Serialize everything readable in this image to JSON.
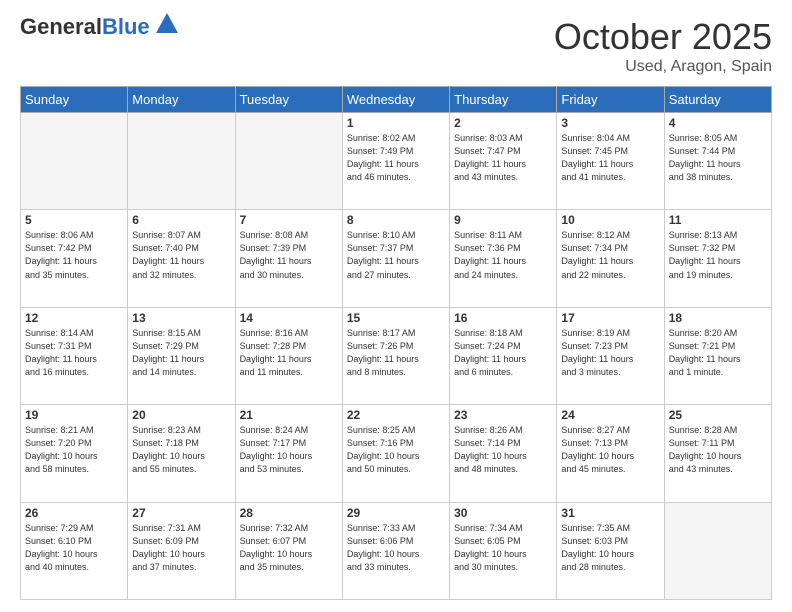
{
  "header": {
    "logo_general": "General",
    "logo_blue": "Blue",
    "title": "October 2025",
    "location": "Used, Aragon, Spain"
  },
  "weekdays": [
    "Sunday",
    "Monday",
    "Tuesday",
    "Wednesday",
    "Thursday",
    "Friday",
    "Saturday"
  ],
  "weeks": [
    [
      {
        "day": "",
        "info": ""
      },
      {
        "day": "",
        "info": ""
      },
      {
        "day": "",
        "info": ""
      },
      {
        "day": "1",
        "info": "Sunrise: 8:02 AM\nSunset: 7:49 PM\nDaylight: 11 hours\nand 46 minutes."
      },
      {
        "day": "2",
        "info": "Sunrise: 8:03 AM\nSunset: 7:47 PM\nDaylight: 11 hours\nand 43 minutes."
      },
      {
        "day": "3",
        "info": "Sunrise: 8:04 AM\nSunset: 7:45 PM\nDaylight: 11 hours\nand 41 minutes."
      },
      {
        "day": "4",
        "info": "Sunrise: 8:05 AM\nSunset: 7:44 PM\nDaylight: 11 hours\nand 38 minutes."
      }
    ],
    [
      {
        "day": "5",
        "info": "Sunrise: 8:06 AM\nSunset: 7:42 PM\nDaylight: 11 hours\nand 35 minutes."
      },
      {
        "day": "6",
        "info": "Sunrise: 8:07 AM\nSunset: 7:40 PM\nDaylight: 11 hours\nand 32 minutes."
      },
      {
        "day": "7",
        "info": "Sunrise: 8:08 AM\nSunset: 7:39 PM\nDaylight: 11 hours\nand 30 minutes."
      },
      {
        "day": "8",
        "info": "Sunrise: 8:10 AM\nSunset: 7:37 PM\nDaylight: 11 hours\nand 27 minutes."
      },
      {
        "day": "9",
        "info": "Sunrise: 8:11 AM\nSunset: 7:36 PM\nDaylight: 11 hours\nand 24 minutes."
      },
      {
        "day": "10",
        "info": "Sunrise: 8:12 AM\nSunset: 7:34 PM\nDaylight: 11 hours\nand 22 minutes."
      },
      {
        "day": "11",
        "info": "Sunrise: 8:13 AM\nSunset: 7:32 PM\nDaylight: 11 hours\nand 19 minutes."
      }
    ],
    [
      {
        "day": "12",
        "info": "Sunrise: 8:14 AM\nSunset: 7:31 PM\nDaylight: 11 hours\nand 16 minutes."
      },
      {
        "day": "13",
        "info": "Sunrise: 8:15 AM\nSunset: 7:29 PM\nDaylight: 11 hours\nand 14 minutes."
      },
      {
        "day": "14",
        "info": "Sunrise: 8:16 AM\nSunset: 7:28 PM\nDaylight: 11 hours\nand 11 minutes."
      },
      {
        "day": "15",
        "info": "Sunrise: 8:17 AM\nSunset: 7:26 PM\nDaylight: 11 hours\nand 8 minutes."
      },
      {
        "day": "16",
        "info": "Sunrise: 8:18 AM\nSunset: 7:24 PM\nDaylight: 11 hours\nand 6 minutes."
      },
      {
        "day": "17",
        "info": "Sunrise: 8:19 AM\nSunset: 7:23 PM\nDaylight: 11 hours\nand 3 minutes."
      },
      {
        "day": "18",
        "info": "Sunrise: 8:20 AM\nSunset: 7:21 PM\nDaylight: 11 hours\nand 1 minute."
      }
    ],
    [
      {
        "day": "19",
        "info": "Sunrise: 8:21 AM\nSunset: 7:20 PM\nDaylight: 10 hours\nand 58 minutes."
      },
      {
        "day": "20",
        "info": "Sunrise: 8:23 AM\nSunset: 7:18 PM\nDaylight: 10 hours\nand 55 minutes."
      },
      {
        "day": "21",
        "info": "Sunrise: 8:24 AM\nSunset: 7:17 PM\nDaylight: 10 hours\nand 53 minutes."
      },
      {
        "day": "22",
        "info": "Sunrise: 8:25 AM\nSunset: 7:16 PM\nDaylight: 10 hours\nand 50 minutes."
      },
      {
        "day": "23",
        "info": "Sunrise: 8:26 AM\nSunset: 7:14 PM\nDaylight: 10 hours\nand 48 minutes."
      },
      {
        "day": "24",
        "info": "Sunrise: 8:27 AM\nSunset: 7:13 PM\nDaylight: 10 hours\nand 45 minutes."
      },
      {
        "day": "25",
        "info": "Sunrise: 8:28 AM\nSunset: 7:11 PM\nDaylight: 10 hours\nand 43 minutes."
      }
    ],
    [
      {
        "day": "26",
        "info": "Sunrise: 7:29 AM\nSunset: 6:10 PM\nDaylight: 10 hours\nand 40 minutes."
      },
      {
        "day": "27",
        "info": "Sunrise: 7:31 AM\nSunset: 6:09 PM\nDaylight: 10 hours\nand 37 minutes."
      },
      {
        "day": "28",
        "info": "Sunrise: 7:32 AM\nSunset: 6:07 PM\nDaylight: 10 hours\nand 35 minutes."
      },
      {
        "day": "29",
        "info": "Sunrise: 7:33 AM\nSunset: 6:06 PM\nDaylight: 10 hours\nand 33 minutes."
      },
      {
        "day": "30",
        "info": "Sunrise: 7:34 AM\nSunset: 6:05 PM\nDaylight: 10 hours\nand 30 minutes."
      },
      {
        "day": "31",
        "info": "Sunrise: 7:35 AM\nSunset: 6:03 PM\nDaylight: 10 hours\nand 28 minutes."
      },
      {
        "day": "",
        "info": ""
      }
    ]
  ]
}
